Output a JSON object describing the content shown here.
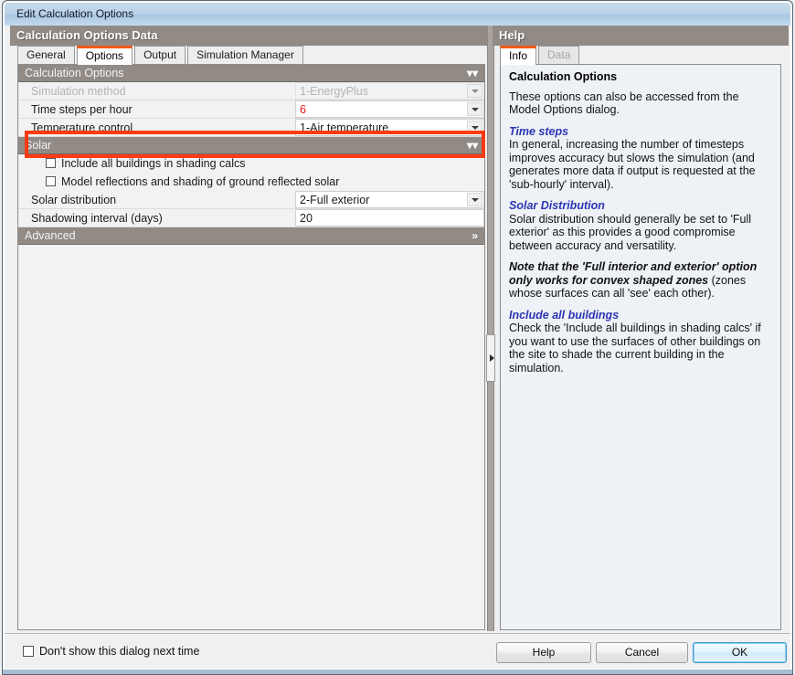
{
  "window": {
    "title": "Edit Calculation Options"
  },
  "left_pane": {
    "header": "Calculation Options Data",
    "tabs": [
      {
        "label": "General",
        "active": false,
        "disabled": false
      },
      {
        "label": "Options",
        "active": true,
        "disabled": false
      },
      {
        "label": "Output",
        "active": false,
        "disabled": false
      },
      {
        "label": "Simulation Manager",
        "active": false,
        "disabled": false
      }
    ],
    "sections": {
      "calculation_options": {
        "title": "Calculation Options",
        "chevron": "»",
        "rows": [
          {
            "label": "Simulation method",
            "value": "1-EnergyPlus",
            "type": "combo",
            "disabled": true,
            "highlight": false
          },
          {
            "label": "Time steps per hour",
            "value": "6",
            "type": "combo",
            "disabled": false,
            "highlight": true
          },
          {
            "label": "Temperature control",
            "value": "1-Air temperature",
            "type": "combo",
            "disabled": false,
            "highlight": false
          }
        ]
      },
      "solar": {
        "title": "Solar",
        "chevron": "»",
        "checkboxes": [
          {
            "label": "Include all buildings in shading calcs",
            "checked": false
          },
          {
            "label": "Model reflections and shading of ground reflected solar",
            "checked": false
          }
        ],
        "rows": [
          {
            "label": "Solar distribution",
            "value": "2-Full exterior",
            "type": "combo",
            "disabled": false
          },
          {
            "label": "Shadowing interval (days)",
            "value": "20",
            "type": "text",
            "disabled": false
          }
        ]
      },
      "advanced": {
        "title": "Advanced",
        "chevron": "»"
      }
    }
  },
  "help_pane": {
    "header": "Help",
    "tabs": [
      {
        "label": "Info",
        "active": true,
        "disabled": false
      },
      {
        "label": "Data",
        "active": false,
        "disabled": true
      }
    ],
    "title": "Calculation Options",
    "intro": "These options can also be accessed from the Model Options dialog.",
    "time_steps_heading": "Time steps",
    "time_steps_body": "In general, increasing the number of timesteps improves accuracy but slows the simulation (and generates more data if output is requested at the 'sub-hourly' interval).",
    "solar_dist_heading": "Solar Distribution",
    "solar_dist_body": "Solar distribution should generally be set to 'Full exterior' as this provides a good compromise between accuracy and versatility.",
    "note_bold": "Note that the 'Full interior and exterior' option only works for convex shaped zones",
    "note_rest": " (zones whose surfaces can all 'see' each other).",
    "include_all_heading": "Include all buildings",
    "include_all_body": "Check the 'Include all buildings in shading calcs' if you want to use the surfaces of other buildings on the site to shade the current building in the simulation."
  },
  "footer": {
    "dont_show_label": "Don't show this dialog next time",
    "dont_show_checked": false,
    "help_button": "Help",
    "cancel_button": "Cancel",
    "ok_button": "OK"
  },
  "colors": {
    "accent_orange": "#f05a12",
    "highlight_red": "#fc3b12",
    "value_red": "#e21b1b",
    "header_gray": "#918a85",
    "titlebar_blue": "#bcd3e8",
    "help_link_blue": "#2b35b5"
  }
}
